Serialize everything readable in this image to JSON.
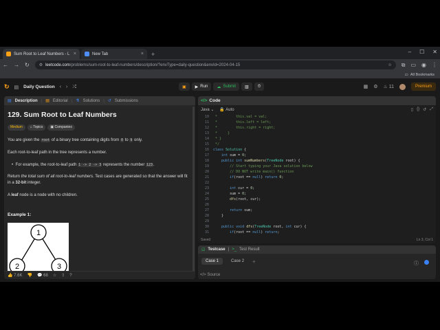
{
  "browser": {
    "tabs": [
      {
        "label": "Sum Root to Leaf Numbers - L",
        "favicon_color": "#ffa116"
      },
      {
        "label": "New Tab",
        "favicon_color": "#4f8cff"
      }
    ],
    "url_host": "leetcode.com",
    "url_path": "/problems/sum-root-to-leaf-numbers/description/?envType=daily-question&envId=2024-04-15",
    "bookmarks_label": "All Bookmarks"
  },
  "nav": {
    "daily_question": "Daily Question",
    "run": "Run",
    "submit": "Submit",
    "streak": "11",
    "premium": "Premium"
  },
  "problem": {
    "tabs": [
      "Description",
      "Editorial",
      "Solutions",
      "Submissions"
    ],
    "title": "129. Sum Root to Leaf Numbers",
    "difficulty": "Medium",
    "topics": "Topics",
    "companies": "Companies",
    "p1_a": "You are given the",
    "p1_code1": "root",
    "p1_b": "of a binary tree containing digits from",
    "p1_code2": "0",
    "p1_c": "to",
    "p1_code3": "9",
    "p1_d": "only.",
    "p2": "Each root-to-leaf path in the tree represents a number.",
    "b1_a": "For example, the root-to-leaf path",
    "b1_code1": "1 -> 2 -> 3",
    "b1_b": "represents the number",
    "b1_code2": "123",
    "b1_c": ".",
    "p3_a": "Return",
    "p3_em": "the total sum of all root-to-leaf numbers",
    "p3_b": ". Test cases are generated so that the answer will fit in a",
    "p3_strong": "32-bit",
    "p3_c": "integer.",
    "p4_a": "A",
    "p4_strong": "leaf",
    "p4_b": "node is a node with no children.",
    "example": "Example 1:",
    "tree_nodes": [
      "1",
      "2",
      "3"
    ],
    "likes": "7.6K",
    "comments": "68"
  },
  "editor": {
    "header": "Code",
    "language": "Java",
    "mode": "Auto",
    "status": "Saved",
    "cursor": "Ln 3, Col 1",
    "line_numbers": [
      "10",
      "11",
      "12",
      "13",
      "14",
      "15",
      "16",
      "17",
      "18",
      "19",
      "20",
      "21",
      "22",
      "23",
      "24",
      "25",
      "26",
      "27",
      "28",
      "29",
      "30",
      "31"
    ],
    "lines": [
      " *         this.val = val;",
      " *         this.left = left;",
      " *         this.right = right;",
      " *     }",
      " * }",
      " */",
      "class Solution {",
      "    int sum = 0;",
      "    public int sumNumbers(TreeNode root) {",
      "        // Start typing your Java solution below",
      "        // DO NOT write main() function",
      "        if(root == null) return 0;",
      "",
      "        int cur = 0;",
      "        sum = 0;",
      "        dfs(root, cur);",
      "",
      "        return sum;",
      "    }",
      "",
      "    public void dfs(TreeNode root, int cur) {",
      "        if(root == null) return;"
    ]
  },
  "testpanel": {
    "testcase": "Testcase",
    "result": "Test Result",
    "case1": "Case 1",
    "case2": "Case 2",
    "source": "Source"
  }
}
